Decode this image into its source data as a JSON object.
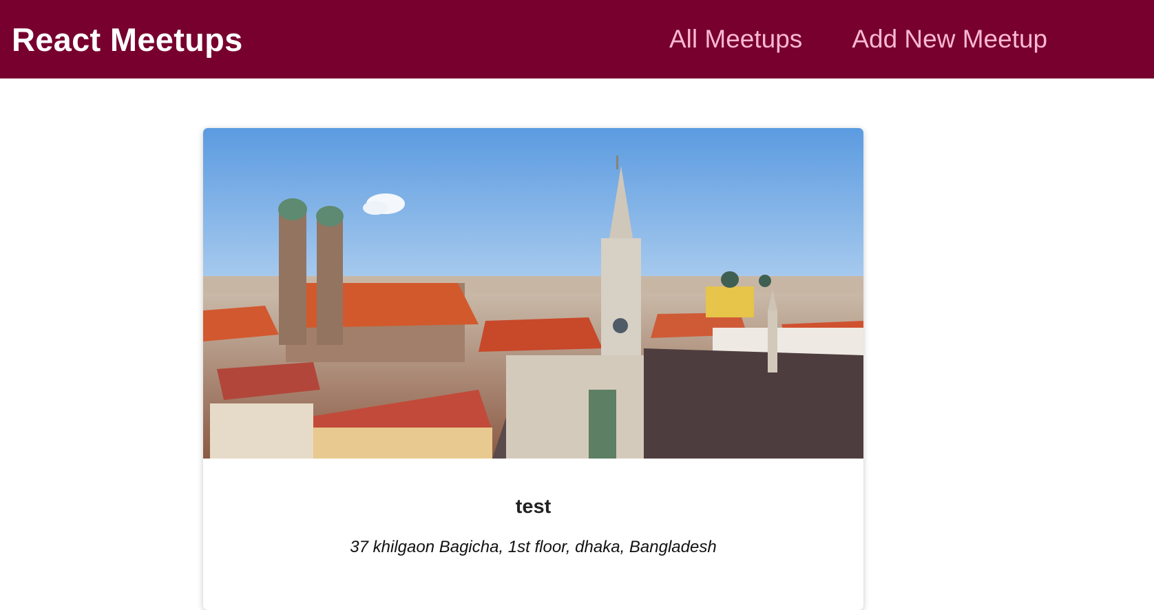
{
  "header": {
    "logo": "React Meetups",
    "nav": [
      {
        "label": "All Meetups"
      },
      {
        "label": "Add New Meetup"
      }
    ]
  },
  "meetups": [
    {
      "title": "test",
      "address": "37 khilgaon Bagicha, 1st floor, dhaka, Bangladesh"
    }
  ],
  "colors": {
    "header_bg": "#77002e",
    "nav_link": "#fcb8d2",
    "logo": "#ffffff"
  }
}
